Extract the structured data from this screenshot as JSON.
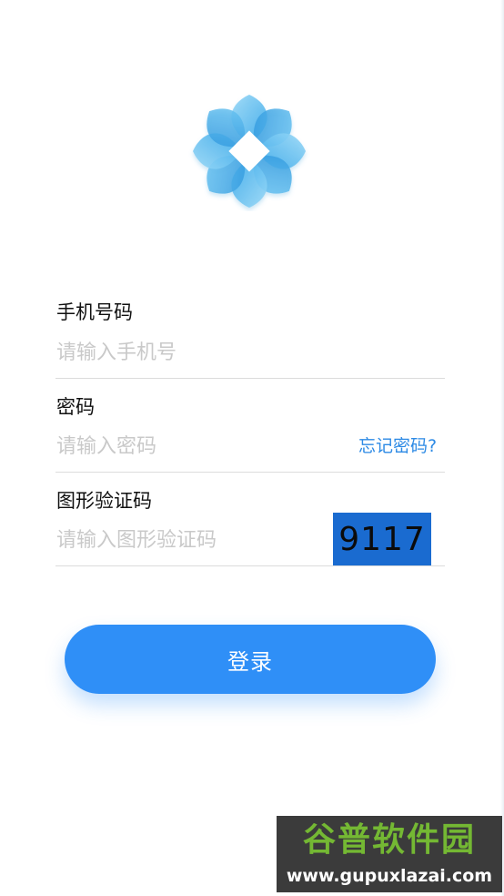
{
  "logo": {
    "icon": "lotus-logo-icon",
    "colors": {
      "light": "#8fd4f5",
      "mid": "#4ab8ee",
      "dark": "#2a9be0"
    }
  },
  "form": {
    "phone": {
      "label": "手机号码",
      "placeholder": "请输入手机号",
      "value": ""
    },
    "password": {
      "label": "密码",
      "placeholder": "请输入密码",
      "value": "",
      "forgot_label": "忘记密码?"
    },
    "captcha": {
      "label": "图形验证码",
      "placeholder": "请输入图形验证码",
      "value": "",
      "image_code": "9117"
    },
    "submit_label": "登录"
  },
  "watermark": {
    "title": "谷普软件园",
    "url": "www.gupuxlazai.com"
  },
  "colors": {
    "accent": "#2f8ff7",
    "link": "#2d8ae5",
    "captcha_bg": "#1a6bd0"
  }
}
